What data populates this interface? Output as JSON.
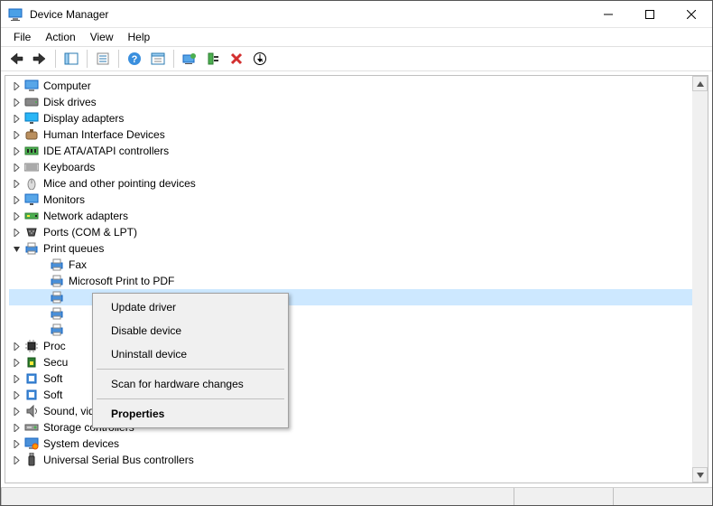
{
  "window": {
    "title": "Device Manager"
  },
  "menubar": {
    "file": "File",
    "action": "Action",
    "view": "View",
    "help": "Help"
  },
  "toolbar_icons": {
    "back": "back-arrow",
    "forward": "forward-arrow",
    "up": "show-hidden",
    "props": "properties",
    "help": "help",
    "refresh": "refresh",
    "scan": "scan-hardware",
    "enable": "enable-device",
    "uninstall": "uninstall",
    "update": "update-driver"
  },
  "tree": {
    "categories": [
      {
        "label": "Computer",
        "icon": "computer",
        "expanded": false
      },
      {
        "label": "Disk drives",
        "icon": "disk",
        "expanded": false
      },
      {
        "label": "Display adapters",
        "icon": "display",
        "expanded": false
      },
      {
        "label": "Human Interface Devices",
        "icon": "hid",
        "expanded": false
      },
      {
        "label": "IDE ATA/ATAPI controllers",
        "icon": "ide",
        "expanded": false
      },
      {
        "label": "Keyboards",
        "icon": "keyboard",
        "expanded": false
      },
      {
        "label": "Mice and other pointing devices",
        "icon": "mouse",
        "expanded": false
      },
      {
        "label": "Monitors",
        "icon": "monitor",
        "expanded": false
      },
      {
        "label": "Network adapters",
        "icon": "network",
        "expanded": false
      },
      {
        "label": "Ports (COM & LPT)",
        "icon": "port",
        "expanded": false
      },
      {
        "label": "Print queues",
        "icon": "printer",
        "expanded": true,
        "children": [
          {
            "label": "Fax",
            "icon": "printer"
          },
          {
            "label": "Microsoft Print to PDF",
            "icon": "printer"
          },
          {
            "label": "",
            "icon": "printer",
            "selected": true
          },
          {
            "label": "",
            "icon": "printer"
          },
          {
            "label": "",
            "icon": "printer"
          }
        ]
      },
      {
        "label": "Proc",
        "icon": "processor",
        "expanded": false,
        "truncated": true
      },
      {
        "label": "Secu",
        "icon": "security",
        "expanded": false,
        "truncated": true
      },
      {
        "label": "Soft",
        "icon": "software",
        "expanded": false,
        "truncated": true
      },
      {
        "label": "Soft",
        "icon": "software",
        "expanded": false,
        "truncated": true
      },
      {
        "label": "Sound, video and game controllers",
        "icon": "sound",
        "expanded": false
      },
      {
        "label": "Storage controllers",
        "icon": "storage",
        "expanded": false
      },
      {
        "label": "System devices",
        "icon": "system",
        "expanded": false
      },
      {
        "label": "Universal Serial Bus controllers",
        "icon": "usb",
        "expanded": false
      }
    ]
  },
  "context_menu": {
    "update": "Update driver",
    "disable": "Disable device",
    "uninstall": "Uninstall device",
    "scan": "Scan for hardware changes",
    "properties": "Properties"
  }
}
